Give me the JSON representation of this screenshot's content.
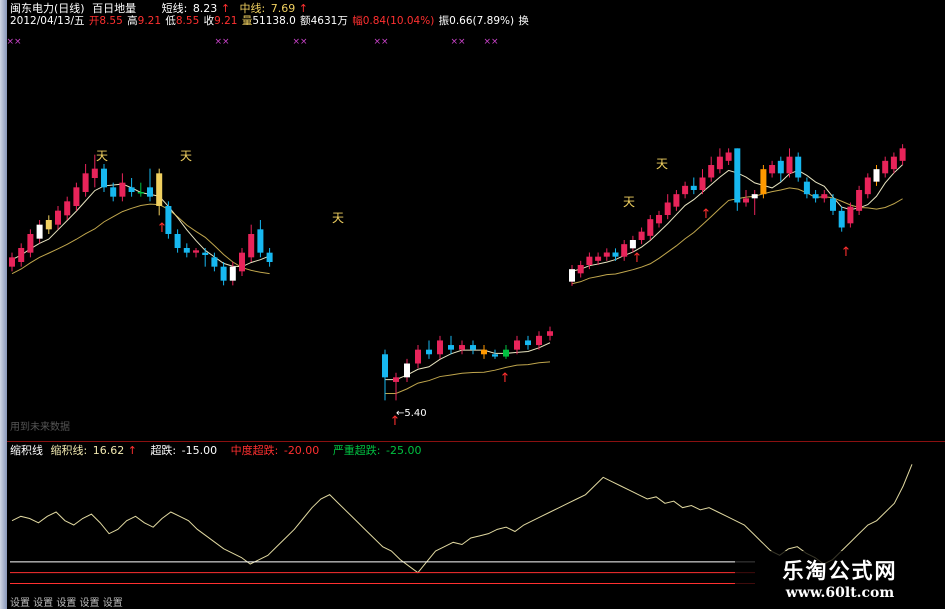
{
  "header": {
    "stock_name": "闽东电力(日线)",
    "indicator_name": "百日地量",
    "short_label": "短线:",
    "short_value": "8.23",
    "mid_label": "中线:",
    "mid_value": "7.69",
    "arrow": "↑"
  },
  "ohlc": {
    "date": "2012/04/13/五",
    "open_label": "开",
    "open": "8.55",
    "high_label": "高",
    "high": "9.21",
    "low_label": "低",
    "low": "8.55",
    "close_label": "收",
    "close": "9.21",
    "vol_label": "量",
    "vol": "51138.0",
    "amount_label": "额",
    "amount": "4631万",
    "chg_label": "幅",
    "chg": "0.84(10.04%)",
    "amp_label": "振",
    "amp": "0.66(7.89%)",
    "turn_label": "换"
  },
  "main_panel": {
    "low_label": "←5.40",
    "future_label": "用到未来数据",
    "sky_glyph": "天",
    "up_marker": "↑",
    "cross_glyph": "××"
  },
  "indicator": {
    "name": "缩积线",
    "line_label": "缩积线:",
    "line_value": "16.62",
    "arrow": "↑",
    "over_label": "超跌:",
    "over_value": "-15.00",
    "mid_label": "中度超跌:",
    "mid_value": "-20.00",
    "severe_label": "严重超跌:",
    "severe_value": "-25.00"
  },
  "footer": "设置    设置    设置    设置    设置",
  "watermark": {
    "title": "乐淘公式网",
    "url": "www.60lt.com"
  },
  "colors": {
    "up": "#e8245a",
    "down": "#17b8f0",
    "yellow": "#f0d060",
    "orange": "#ff9900",
    "green": "#00c040",
    "red": "#ff3030",
    "magenta": "#cc44cc",
    "ma": "#e8e4c0"
  },
  "chart_data": {
    "type": "candlestick",
    "candles": [
      {
        "o": 6.5,
        "c": 6.7,
        "h": 6.8,
        "l": 6.4
      },
      {
        "o": 6.6,
        "c": 6.9,
        "h": 7.0,
        "l": 6.5
      },
      {
        "o": 6.8,
        "c": 7.2,
        "h": 7.3,
        "l": 6.7
      },
      {
        "o": 7.1,
        "c": 7.4,
        "h": 7.5,
        "l": 7.0
      },
      {
        "o": 7.3,
        "c": 7.5,
        "h": 7.6,
        "l": 7.2
      },
      {
        "o": 7.4,
        "c": 7.7,
        "h": 7.8,
        "l": 7.3
      },
      {
        "o": 7.6,
        "c": 7.9,
        "h": 8.0,
        "l": 7.5
      },
      {
        "o": 7.8,
        "c": 8.2,
        "h": 8.3,
        "l": 7.7
      },
      {
        "o": 8.1,
        "c": 8.5,
        "h": 8.7,
        "l": 8.0
      },
      {
        "o": 8.4,
        "c": 8.6,
        "h": 8.9,
        "l": 8.2
      },
      {
        "o": 8.6,
        "c": 8.2,
        "h": 8.7,
        "l": 8.1
      },
      {
        "o": 8.2,
        "c": 8.0,
        "h": 8.3,
        "l": 7.9
      },
      {
        "o": 8.0,
        "c": 8.3,
        "h": 8.5,
        "l": 7.9
      },
      {
        "o": 8.2,
        "c": 8.1,
        "h": 8.4,
        "l": 8.0
      },
      {
        "o": 8.1,
        "c": 8.1,
        "h": 8.3,
        "l": 8.0
      },
      {
        "o": 8.2,
        "c": 8.0,
        "h": 8.6,
        "l": 7.9
      },
      {
        "o": 8.5,
        "c": 7.8,
        "h": 8.6,
        "l": 7.6
      },
      {
        "o": 7.8,
        "c": 7.2,
        "h": 7.9,
        "l": 7.1
      },
      {
        "o": 7.2,
        "c": 6.9,
        "h": 7.3,
        "l": 6.8
      },
      {
        "o": 6.9,
        "c": 6.8,
        "h": 7.0,
        "l": 6.7
      },
      {
        "o": 6.8,
        "c": 6.85,
        "h": 6.9,
        "l": 6.7
      },
      {
        "o": 6.8,
        "c": 6.75,
        "h": 6.9,
        "l": 6.5
      },
      {
        "o": 6.7,
        "c": 6.5,
        "h": 6.8,
        "l": 6.4
      },
      {
        "o": 6.5,
        "c": 6.2,
        "h": 6.6,
        "l": 6.1
      },
      {
        "o": 6.2,
        "c": 6.5,
        "h": 6.6,
        "l": 6.1
      },
      {
        "o": 6.4,
        "c": 6.8,
        "h": 6.9,
        "l": 6.3
      },
      {
        "o": 6.7,
        "c": 7.2,
        "h": 7.4,
        "l": 6.6
      },
      {
        "o": 7.3,
        "c": 6.8,
        "h": 7.5,
        "l": 6.7
      },
      {
        "o": 6.8,
        "c": 6.6,
        "h": 6.9,
        "l": 6.5
      },
      {
        "o": 6.4,
        "c": 5.9,
        "h": 6.5,
        "l": 5.4
      },
      {
        "o": 5.8,
        "c": 5.9,
        "h": 6.0,
        "l": 5.4
      },
      {
        "o": 5.9,
        "c": 6.2,
        "h": 6.3,
        "l": 5.8
      },
      {
        "o": 6.2,
        "c": 6.5,
        "h": 6.6,
        "l": 6.1
      },
      {
        "o": 6.5,
        "c": 6.4,
        "h": 6.7,
        "l": 6.3
      },
      {
        "o": 6.4,
        "c": 6.7,
        "h": 6.8,
        "l": 6.3
      },
      {
        "o": 6.6,
        "c": 6.5,
        "h": 6.8,
        "l": 6.4
      },
      {
        "o": 6.5,
        "c": 6.6,
        "h": 6.7,
        "l": 6.4
      },
      {
        "o": 6.6,
        "c": 6.5,
        "h": 6.7,
        "l": 6.4
      },
      {
        "o": 6.5,
        "c": 6.4,
        "h": 6.6,
        "l": 6.3
      },
      {
        "o": 6.4,
        "c": 6.35,
        "h": 6.5,
        "l": 6.3
      },
      {
        "o": 6.35,
        "c": 6.5,
        "h": 6.6,
        "l": 6.3
      },
      {
        "o": 6.5,
        "c": 6.7,
        "h": 6.8,
        "l": 6.4
      },
      {
        "o": 6.7,
        "c": 6.6,
        "h": 6.8,
        "l": 6.5
      },
      {
        "o": 6.6,
        "c": 6.8,
        "h": 6.9,
        "l": 6.5
      },
      {
        "o": 6.8,
        "c": 6.9,
        "h": 7.0,
        "l": 6.7
      },
      {
        "o": 6.6,
        "c": 6.9,
        "h": 7.0,
        "l": 6.5
      },
      {
        "o": 6.8,
        "c": 7.0,
        "h": 7.1,
        "l": 6.7
      },
      {
        "o": 7.0,
        "c": 7.2,
        "h": 7.3,
        "l": 6.9
      },
      {
        "o": 7.1,
        "c": 7.2,
        "h": 7.3,
        "l": 7.0
      },
      {
        "o": 7.2,
        "c": 7.3,
        "h": 7.4,
        "l": 7.1
      },
      {
        "o": 7.3,
        "c": 7.2,
        "h": 7.4,
        "l": 7.1
      },
      {
        "o": 7.2,
        "c": 7.5,
        "h": 7.6,
        "l": 7.1
      },
      {
        "o": 7.4,
        "c": 7.6,
        "h": 7.7,
        "l": 7.3
      },
      {
        "o": 7.6,
        "c": 7.8,
        "h": 7.9,
        "l": 7.5
      },
      {
        "o": 7.7,
        "c": 8.1,
        "h": 8.2,
        "l": 7.6
      },
      {
        "o": 8.0,
        "c": 8.2,
        "h": 8.3,
        "l": 7.9
      },
      {
        "o": 8.2,
        "c": 8.5,
        "h": 8.7,
        "l": 8.1
      },
      {
        "o": 8.4,
        "c": 8.7,
        "h": 8.8,
        "l": 8.3
      },
      {
        "o": 8.7,
        "c": 8.9,
        "h": 9.0,
        "l": 8.6
      },
      {
        "o": 8.9,
        "c": 8.8,
        "h": 9.1,
        "l": 8.7
      },
      {
        "o": 8.8,
        "c": 9.1,
        "h": 9.3,
        "l": 8.7
      },
      {
        "o": 9.1,
        "c": 9.4,
        "h": 9.6,
        "l": 9.0
      },
      {
        "o": 9.3,
        "c": 9.6,
        "h": 9.8,
        "l": 9.2
      },
      {
        "o": 9.5,
        "c": 9.7,
        "h": 9.8,
        "l": 9.4
      },
      {
        "o": 9.8,
        "c": 8.5,
        "h": 9.8,
        "l": 8.3
      },
      {
        "o": 8.5,
        "c": 8.6,
        "h": 8.8,
        "l": 8.4
      },
      {
        "o": 8.6,
        "c": 8.7,
        "h": 8.8,
        "l": 8.2
      },
      {
        "o": 8.7,
        "c": 9.3,
        "h": 9.4,
        "l": 8.6
      },
      {
        "o": 9.2,
        "c": 9.4,
        "h": 9.5,
        "l": 9.1
      },
      {
        "o": 9.5,
        "c": 9.2,
        "h": 9.6,
        "l": 9.0
      },
      {
        "o": 9.2,
        "c": 9.6,
        "h": 9.8,
        "l": 9.1
      },
      {
        "o": 9.6,
        "c": 9.1,
        "h": 9.7,
        "l": 9.0
      },
      {
        "o": 9.0,
        "c": 8.7,
        "h": 9.1,
        "l": 8.6
      },
      {
        "o": 8.7,
        "c": 8.6,
        "h": 8.8,
        "l": 8.5
      },
      {
        "o": 8.6,
        "c": 8.7,
        "h": 8.8,
        "l": 8.5
      },
      {
        "o": 8.6,
        "c": 8.3,
        "h": 8.7,
        "l": 8.2
      },
      {
        "o": 8.3,
        "c": 7.9,
        "h": 8.4,
        "l": 7.8
      },
      {
        "o": 8.0,
        "c": 8.4,
        "h": 8.5,
        "l": 7.9
      },
      {
        "o": 8.3,
        "c": 8.8,
        "h": 8.9,
        "l": 8.2
      },
      {
        "o": 8.7,
        "c": 9.1,
        "h": 9.2,
        "l": 8.6
      },
      {
        "o": 9.0,
        "c": 9.3,
        "h": 9.4,
        "l": 8.9
      },
      {
        "o": 9.2,
        "c": 9.5,
        "h": 9.6,
        "l": 9.1
      },
      {
        "o": 9.3,
        "c": 9.6,
        "h": 9.7,
        "l": 9.2
      },
      {
        "o": 9.5,
        "c": 9.8,
        "h": 9.9,
        "l": 9.4
      }
    ],
    "indicator_series": [
      4,
      6,
      5,
      3,
      6,
      8,
      4,
      2,
      5,
      7,
      3,
      -2,
      0,
      4,
      6,
      3,
      1,
      5,
      8,
      6,
      4,
      0,
      -3,
      -6,
      -9,
      -11,
      -13,
      -16,
      -14,
      -12,
      -8,
      -4,
      0,
      5,
      10,
      14,
      16,
      12,
      8,
      4,
      0,
      -4,
      -8,
      -10,
      -14,
      -17,
      -20,
      -15,
      -10,
      -8,
      -6,
      -7,
      -4,
      -3,
      -2,
      0,
      1,
      -1,
      2,
      4,
      6,
      8,
      10,
      12,
      14,
      16,
      20,
      24,
      22,
      20,
      18,
      16,
      14,
      15,
      12,
      13,
      10,
      11,
      9,
      10,
      8,
      6,
      4,
      2,
      -2,
      -6,
      -10,
      -12,
      -9,
      -8,
      -11,
      -13,
      -16,
      -14,
      -10,
      -6,
      -2,
      2,
      4,
      8,
      12,
      20,
      30
    ],
    "overbought_lines": [
      -15,
      -20,
      -25
    ]
  }
}
